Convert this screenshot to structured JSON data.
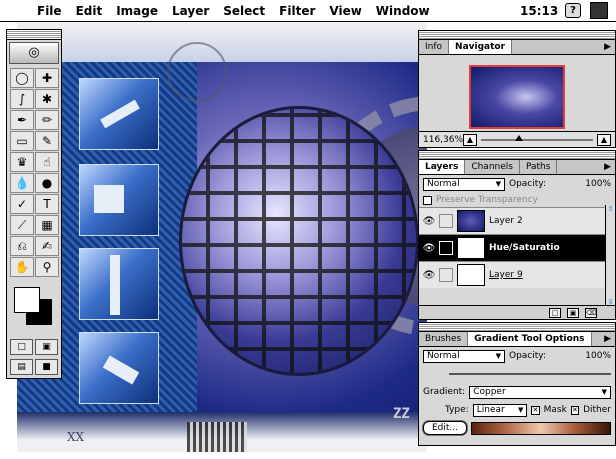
{
  "menubar": {
    "apple_glyph": "",
    "menus": [
      "File",
      "Edit",
      "Image",
      "Layer",
      "Select",
      "Filter",
      "View",
      "Window"
    ],
    "clock": "15:13",
    "help_glyph": "?"
  },
  "canvas": {
    "overlay_text_zz": "ZZ",
    "overlay_text_xx": "XX"
  },
  "navigator": {
    "tabs": [
      "Info",
      "Navigator"
    ],
    "zoom": "116,36%"
  },
  "layers_panel": {
    "tabs": [
      "Layers",
      "Channels",
      "Paths"
    ],
    "blend_mode": "Normal",
    "opacity_label": "Opacity:",
    "opacity_value": "100%",
    "preserve_transparency": "Preserve Transparency",
    "layers": [
      {
        "name": "Layer 2"
      },
      {
        "name": "Hue/Saturatio"
      },
      {
        "name": "Layer 9"
      }
    ]
  },
  "gradient_panel": {
    "tabs": [
      "Brushes",
      "Gradient Tool Options"
    ],
    "blend_mode": "Normal",
    "opacity_label": "Opacity:",
    "opacity_value": "100%",
    "gradient_label": "Gradient:",
    "gradient_value": "Copper",
    "type_label": "Type:",
    "type_value": "Linear",
    "mask_label": "Mask",
    "dither_label": "Dither",
    "edit_button": "Edit..."
  }
}
